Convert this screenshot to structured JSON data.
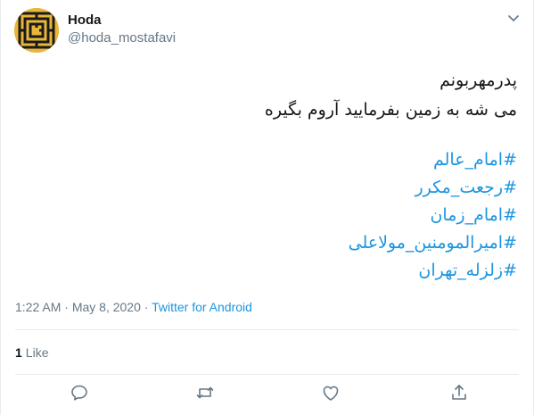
{
  "author": {
    "display_name": "Hoda",
    "handle": "@hoda_mostafavi"
  },
  "tweet": {
    "lines": [
      "پدرمهربونم",
      "می شه به زمین بفرمایید آروم بگیره"
    ],
    "hashtags": [
      "#امام_عالم",
      "#رجعت_مکرر",
      "#امام_زمان",
      "#امیرالمومنین_مولاعلی",
      "#زلزله_تهران"
    ]
  },
  "meta": {
    "time": "1:22 AM",
    "separator1": " · ",
    "date": "May 8, 2020",
    "separator2": " · ",
    "source": "Twitter for Android"
  },
  "stats": {
    "likes_count": "1",
    "likes_label": "Like"
  },
  "icons": {
    "caret": "chevron-down-icon",
    "reply": "reply-icon",
    "retweet": "retweet-icon",
    "like": "heart-icon",
    "share": "share-icon"
  },
  "colors": {
    "link": "#1b95e0",
    "secondary_text": "#657786",
    "primary_text": "#14171a",
    "divider": "#e6ecf0",
    "avatar_bg": "#e8b73a"
  }
}
